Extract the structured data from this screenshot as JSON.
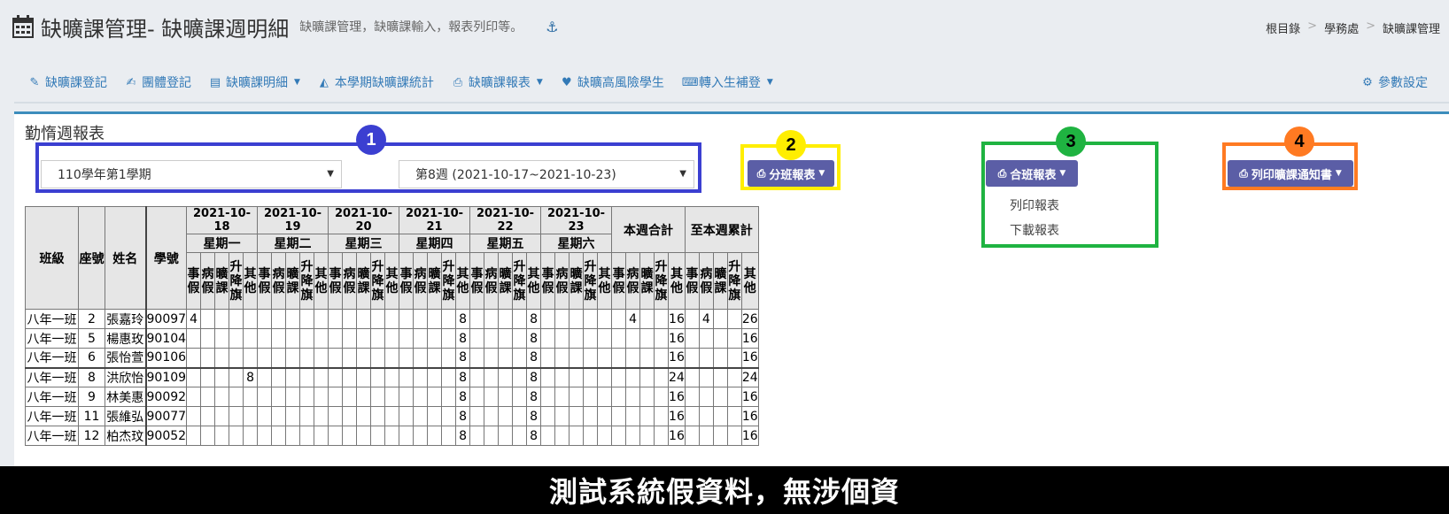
{
  "header": {
    "title": "缺曠課管理- 缺曠課週明細",
    "subtitle": "缺曠課管理，缺曠課輸入，報表列印等。",
    "breadcrumb": [
      "根目錄",
      "學務處",
      "缺曠課管理"
    ]
  },
  "nav": {
    "items": [
      {
        "label": "缺曠課登記",
        "icon": "pencil-icon",
        "dropdown": false
      },
      {
        "label": "團體登記",
        "icon": "edit-icon",
        "dropdown": false
      },
      {
        "label": "缺曠課明細",
        "icon": "document-icon",
        "dropdown": true
      },
      {
        "label": "本學期缺曠課統計",
        "icon": "area-chart-icon",
        "dropdown": false
      },
      {
        "label": "缺曠課報表",
        "icon": "printer-icon",
        "dropdown": true
      },
      {
        "label": "缺曠高風險學生",
        "icon": "heartbeat-icon",
        "dropdown": false
      },
      {
        "label": "轉入生補登",
        "icon": "keyboard-icon",
        "dropdown": true
      }
    ],
    "settings_label": "參數設定"
  },
  "panel": {
    "title": "勤惰週報表",
    "semester_select": "110學年第1學期",
    "week_select": "第8週 (2021-10-17~2021-10-23)",
    "class_report_button": "分班報表",
    "combined_report_button": "合班報表",
    "combined_menu": [
      "列印報表",
      "下載報表"
    ],
    "notice_button": "列印曠課通知書"
  },
  "badges": [
    "1",
    "2",
    "3",
    "4"
  ],
  "colors": {
    "badge1": "#3b3fd1",
    "badge2": "#ffee00",
    "badge3": "#1fb341",
    "badge4": "#ff7a22",
    "button": "#5b5ea6",
    "accent": "#3c8dbc"
  },
  "table": {
    "head": {
      "class": "班級",
      "seat": "座號",
      "name": "姓名",
      "id": "學號",
      "week_total": "本週合計",
      "cumulative": "至本週累計"
    },
    "dates": [
      "2021-10-18",
      "2021-10-19",
      "2021-10-20",
      "2021-10-21",
      "2021-10-22",
      "2021-10-23"
    ],
    "weekdays": [
      "星期一",
      "星期二",
      "星期三",
      "星期四",
      "星期五",
      "星期六"
    ],
    "categories": [
      "事假",
      "病假",
      "曠課",
      "升降旗",
      "其他"
    ],
    "rows": [
      {
        "class": "八年一班",
        "seat": "2",
        "name": "張嘉玲",
        "id": "90097",
        "cells": [
          "4",
          "",
          "",
          "",
          "",
          "",
          "",
          "",
          "",
          "",
          "",
          "",
          "",
          "",
          "",
          "",
          "",
          "",
          "",
          "8",
          "",
          "",
          "",
          "",
          "8",
          "",
          "",
          "",
          "",
          ""
        ],
        "week": [
          "",
          "4",
          "",
          "",
          "16"
        ],
        "cum": [
          "",
          "4",
          "",
          "",
          "26"
        ]
      },
      {
        "class": "八年一班",
        "seat": "5",
        "name": "楊惠玫",
        "id": "90104",
        "cells": [
          "",
          "",
          "",
          "",
          "",
          "",
          "",
          "",
          "",
          "",
          "",
          "",
          "",
          "",
          "",
          "",
          "",
          "",
          "",
          "8",
          "",
          "",
          "",
          "",
          "8",
          "",
          "",
          "",
          "",
          ""
        ],
        "week": [
          "",
          "",
          "",
          "",
          "16"
        ],
        "cum": [
          "",
          "",
          "",
          "",
          "16"
        ]
      },
      {
        "class": "八年一班",
        "seat": "6",
        "name": "張怡萱",
        "id": "90106",
        "cells": [
          "",
          "",
          "",
          "",
          "",
          "",
          "",
          "",
          "",
          "",
          "",
          "",
          "",
          "",
          "",
          "",
          "",
          "",
          "",
          "8",
          "",
          "",
          "",
          "",
          "8",
          "",
          "",
          "",
          "",
          ""
        ],
        "week": [
          "",
          "",
          "",
          "",
          "16"
        ],
        "cum": [
          "",
          "",
          "",
          "",
          "16"
        ]
      },
      {
        "class": "八年一班",
        "seat": "8",
        "name": "洪欣怡",
        "id": "90109",
        "cells": [
          "",
          "",
          "",
          "",
          "8",
          "",
          "",
          "",
          "",
          "",
          "",
          "",
          "",
          "",
          "",
          "",
          "",
          "",
          "",
          "8",
          "",
          "",
          "",
          "",
          "8",
          "",
          "",
          "",
          "",
          ""
        ],
        "week": [
          "",
          "",
          "",
          "",
          "24"
        ],
        "cum": [
          "",
          "",
          "",
          "",
          "24"
        ]
      },
      {
        "class": "八年一班",
        "seat": "9",
        "name": "林美惠",
        "id": "90092",
        "cells": [
          "",
          "",
          "",
          "",
          "",
          "",
          "",
          "",
          "",
          "",
          "",
          "",
          "",
          "",
          "",
          "",
          "",
          "",
          "",
          "8",
          "",
          "",
          "",
          "",
          "8",
          "",
          "",
          "",
          "",
          ""
        ],
        "week": [
          "",
          "",
          "",
          "",
          "16"
        ],
        "cum": [
          "",
          "",
          "",
          "",
          "16"
        ]
      },
      {
        "class": "八年一班",
        "seat": "11",
        "name": "張維弘",
        "id": "90077",
        "cells": [
          "",
          "",
          "",
          "",
          "",
          "",
          "",
          "",
          "",
          "",
          "",
          "",
          "",
          "",
          "",
          "",
          "",
          "",
          "",
          "8",
          "",
          "",
          "",
          "",
          "8",
          "",
          "",
          "",
          "",
          ""
        ],
        "week": [
          "",
          "",
          "",
          "",
          "16"
        ],
        "cum": [
          "",
          "",
          "",
          "",
          "16"
        ]
      },
      {
        "class": "八年一班",
        "seat": "12",
        "name": "柏杰玟",
        "id": "90052",
        "cells": [
          "",
          "",
          "",
          "",
          "",
          "",
          "",
          "",
          "",
          "",
          "",
          "",
          "",
          "",
          "",
          "",
          "",
          "",
          "",
          "8",
          "",
          "",
          "",
          "",
          "8",
          "",
          "",
          "",
          "",
          ""
        ],
        "week": [
          "",
          "",
          "",
          "",
          "16"
        ],
        "cum": [
          "",
          "",
          "",
          "",
          "16"
        ]
      }
    ]
  },
  "banner": "測試系統假資料，無涉個資"
}
